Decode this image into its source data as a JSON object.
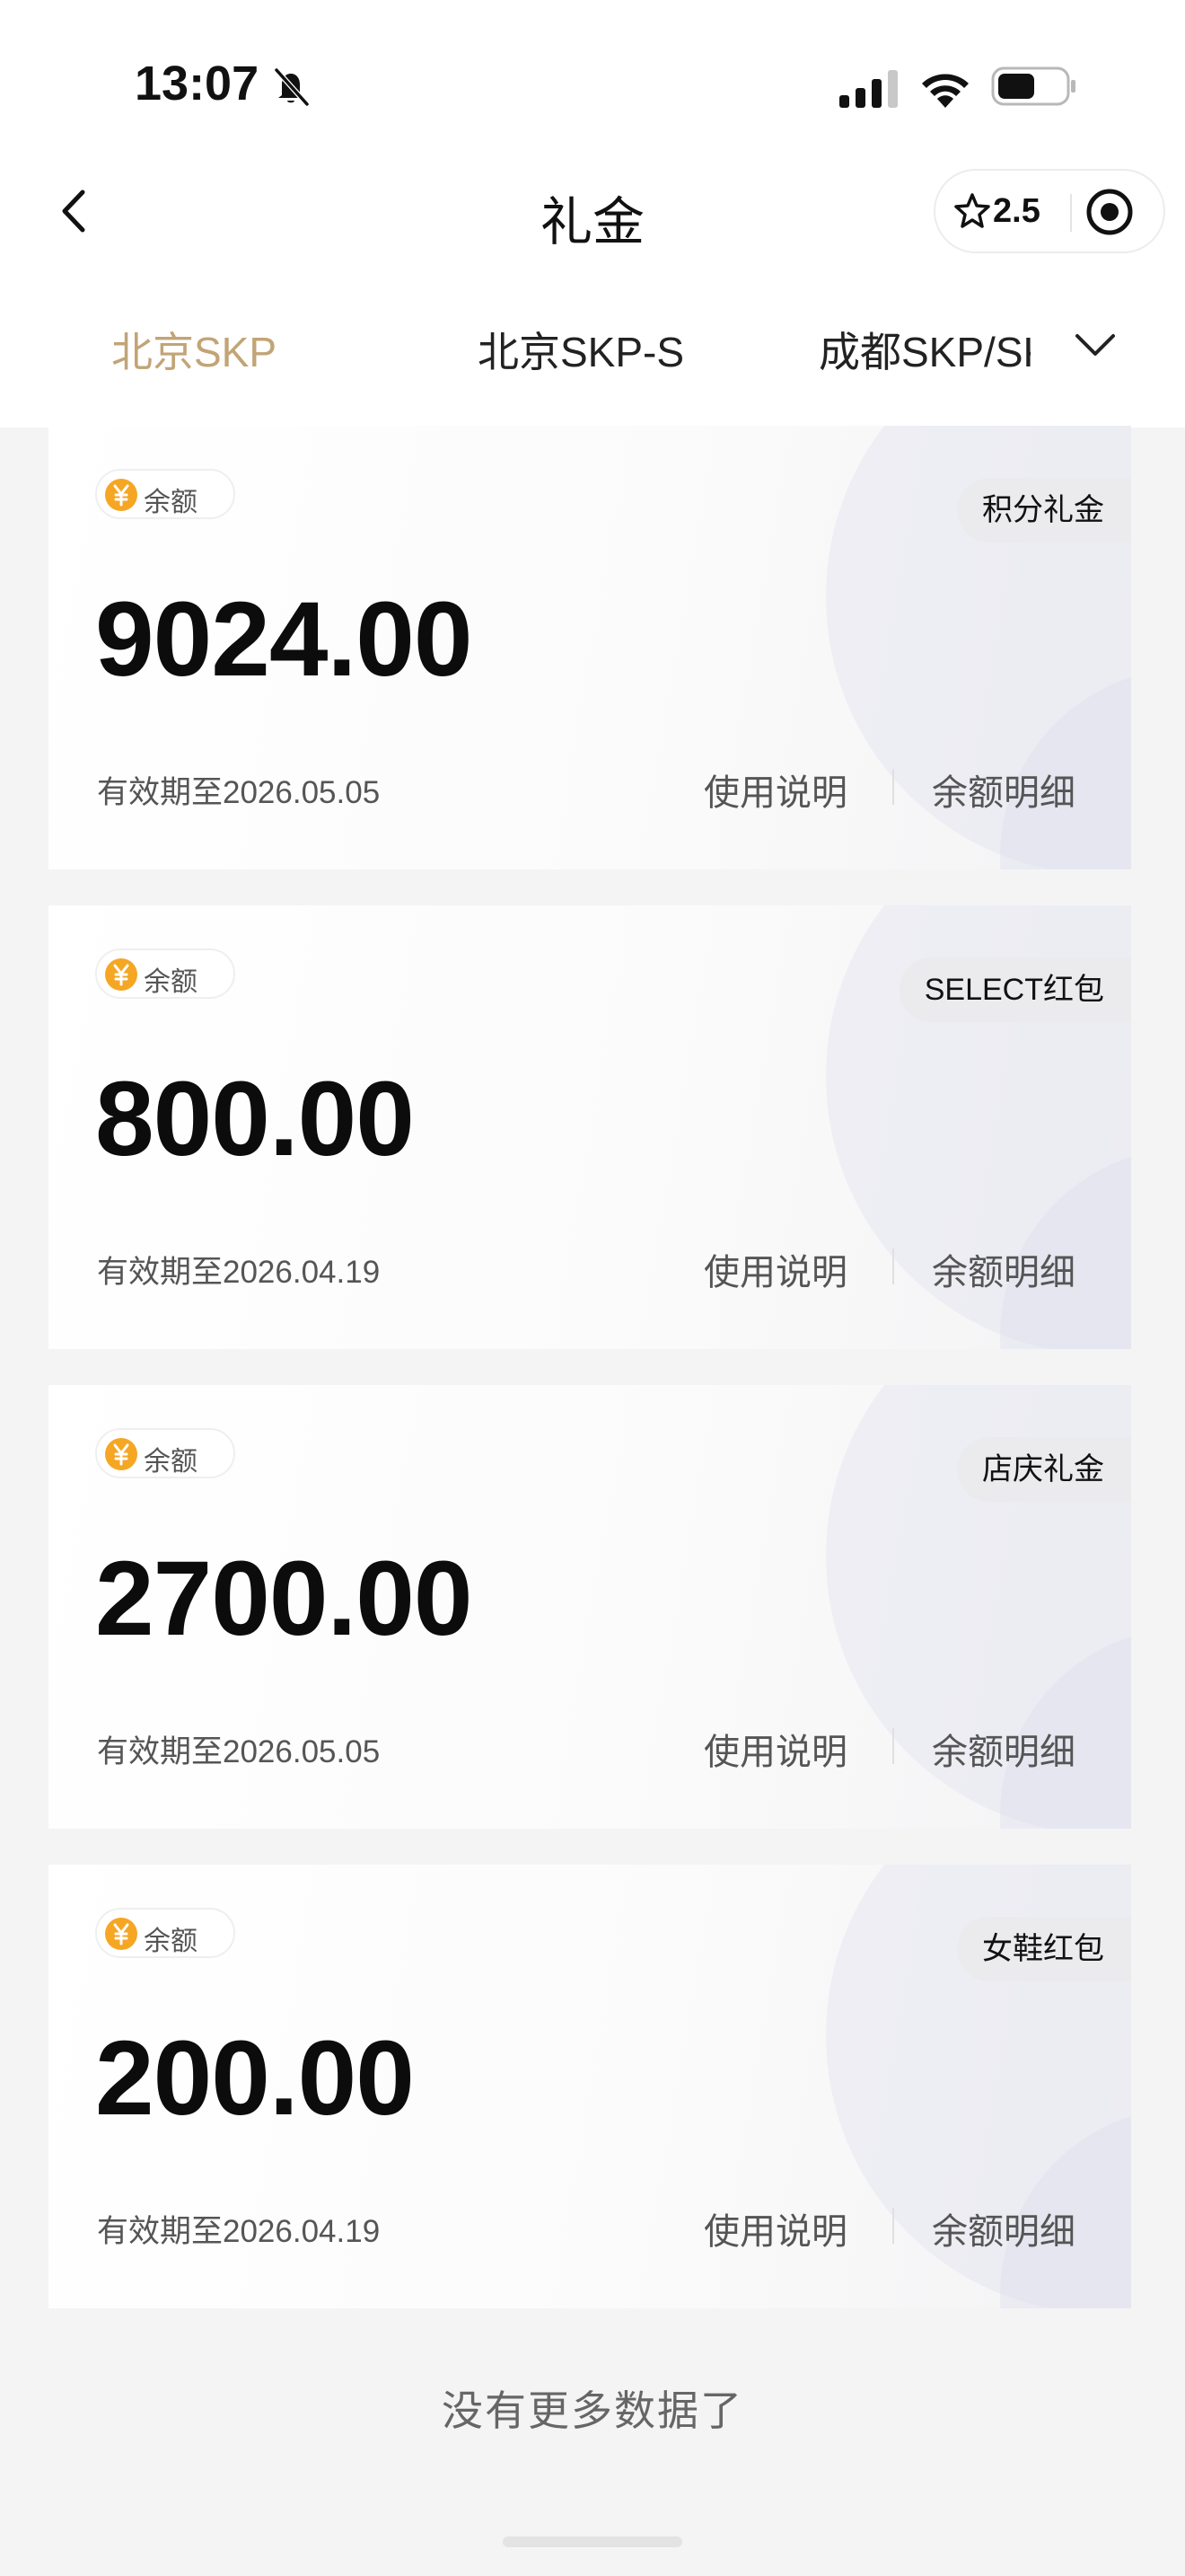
{
  "status_bar": {
    "time": "13:07"
  },
  "nav": {
    "title": "礼金",
    "rating": "2.5"
  },
  "tabs": [
    {
      "label": "北京SKP",
      "active": true
    },
    {
      "label": "北京SKP-S",
      "active": false
    },
    {
      "label": "成都SKP/SKP-S",
      "active": false
    }
  ],
  "cards": [
    {
      "balance_label": "余额",
      "type": "积分礼金",
      "amount": "9024.00",
      "expiry": "有效期至2026.05.05",
      "usage_label": "使用说明",
      "detail_label": "余额明细"
    },
    {
      "balance_label": "余额",
      "type": "SELECT红包",
      "amount": "800.00",
      "expiry": "有效期至2026.04.19",
      "usage_label": "使用说明",
      "detail_label": "余额明细"
    },
    {
      "balance_label": "余额",
      "type": "店庆礼金",
      "amount": "2700.00",
      "expiry": "有效期至2026.05.05",
      "usage_label": "使用说明",
      "detail_label": "余额明细"
    },
    {
      "balance_label": "余额",
      "type": "女鞋红包",
      "amount": "200.00",
      "expiry": "有效期至2026.04.19",
      "usage_label": "使用说明",
      "detail_label": "余额明细"
    }
  ],
  "footer": {
    "no_more": "没有更多数据了"
  },
  "colors": {
    "accent_gold": "#c2a476",
    "yen_orange": "#f5a623",
    "background": "#f4f4f5"
  },
  "icons": [
    "bell-off-icon",
    "signal-icon",
    "wifi-icon",
    "battery-icon",
    "back-icon",
    "star-icon",
    "record-icon",
    "chevron-down-icon",
    "yen-icon"
  ]
}
